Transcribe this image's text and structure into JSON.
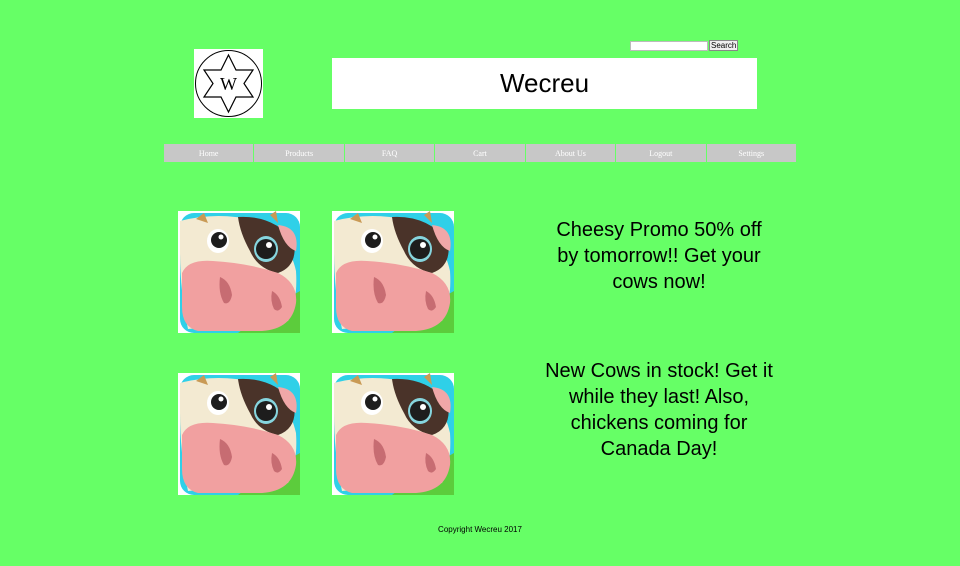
{
  "search": {
    "placeholder": "",
    "button_label": "Search"
  },
  "header": {
    "logo_letter": "W",
    "title": "Wecreu"
  },
  "nav": {
    "items": [
      "Home",
      "Products",
      "FAQ",
      "Cart",
      "About Us",
      "Logout",
      "Settings"
    ]
  },
  "promos": {
    "first": "Cheesy Promo 50% off by tomorrow!! Get your cows now!",
    "second": "New Cows in stock! Get it while they last! Also, chickens coming for Canada Day!"
  },
  "images": {
    "icon": "cow-face-icon"
  },
  "colors": {
    "background": "#66ff66",
    "nav_background": "#c7c7c7",
    "nav_text": "#ffffff"
  },
  "footer": {
    "copyright": "Copyright Wecreu 2017"
  }
}
